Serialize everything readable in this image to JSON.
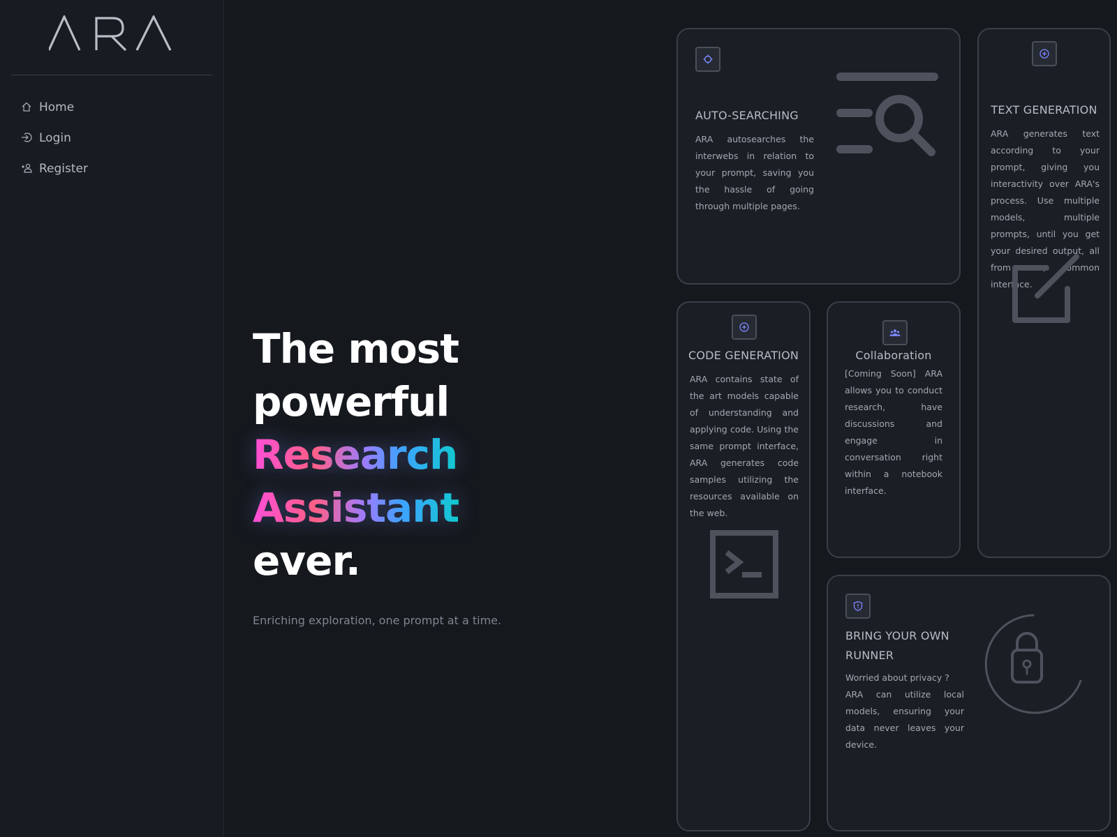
{
  "app": {
    "logo_text": "ARA"
  },
  "sidebar": {
    "items": [
      {
        "label": "Home",
        "icon": "home-icon"
      },
      {
        "label": "Login",
        "icon": "login-icon"
      },
      {
        "label": "Register",
        "icon": "user-plus-icon"
      }
    ]
  },
  "hero": {
    "line1": "The most powerful",
    "highlight_1": "Research",
    "highlight_2": "Assistant",
    "line3": "ever.",
    "subtitle": "Enriching exploration, one prompt at a time."
  },
  "cards": {
    "auto_search": {
      "icon": "crosshair-icon",
      "title": "AUTO-SEARCHING",
      "body": "ARA autosearches the interwebs in relation to your prompt, saving you the hassle of going through multiple pages.",
      "illustration": "search-list-icon"
    },
    "text_gen": {
      "icon": "plus-circle-icon",
      "title": "TEXT GENERATION",
      "body": "ARA generates text according to your prompt, giving you interactivity over ARA's process. Use multiple models, multiple prompts, until you get your desired output, all from one, common interface.",
      "illustration": "edit-icon"
    },
    "code_gen": {
      "icon": "plus-circle-icon",
      "title": "CODE GENERATION",
      "body": "ARA contains state of the art models capable of understanding and applying code. Using the same prompt interface, ARA generates code samples utilizing the resources available on the web.",
      "illustration": "terminal-icon"
    },
    "collab": {
      "icon": "users-icon",
      "title": "Collaboration",
      "body": "[Coming Soon] ARA allows you to conduct research, have discussions and engage in conversation right within a notebook interface."
    },
    "runner": {
      "icon": "shield-icon",
      "title": "BRING YOUR OWN RUNNER",
      "body_line1": "Worried about privacy ?",
      "body_line2": "ARA can utilize local models, ensuring your data never leaves your device.",
      "illustration": "lock-icon"
    }
  },
  "colors": {
    "background": "#15181d",
    "card_bg": "#1b1e25",
    "card_border": "#3b3f48",
    "accent_icon": "#7b88ff",
    "gradient": [
      "#ff4fd8",
      "#ff5f86",
      "#9b7cff",
      "#3fa2ff",
      "#11c9d0"
    ]
  }
}
